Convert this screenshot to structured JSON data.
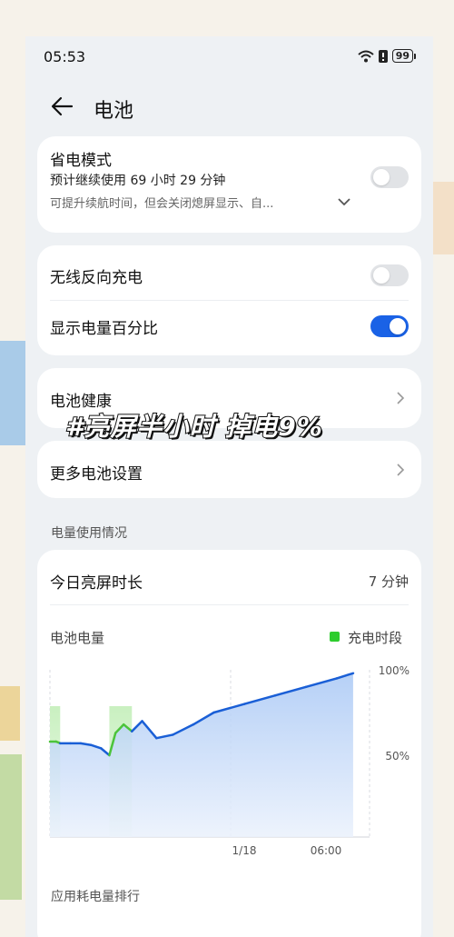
{
  "status_bar": {
    "time": "05:53",
    "battery_level": "99",
    "icons": [
      "wifi-icon",
      "alert-icon",
      "battery-icon"
    ]
  },
  "header": {
    "title": "电池",
    "back_icon": "back-arrow-icon"
  },
  "power_saving": {
    "title": "省电模式",
    "estimate": "预计继续使用 69 小时 29 分钟",
    "description": "可提升续航时间，但会关闭熄屏显示、自...",
    "enabled": false
  },
  "wireless_reverse": {
    "label": "无线反向充电",
    "enabled": false
  },
  "show_percentage": {
    "label": "显示电量百分比",
    "enabled": true
  },
  "battery_health": {
    "label": "电池健康"
  },
  "more_settings": {
    "label": "更多电池设置"
  },
  "overlay_caption": "#亮屏半小时 掉电9%",
  "usage_section": {
    "label": "电量使用情况"
  },
  "screen_time": {
    "label": "今日亮屏时长",
    "value": "7 分钟"
  },
  "chart_header": {
    "title": "电池电量",
    "legend": "充电时段"
  },
  "chart_data": {
    "type": "area",
    "title": "电池电量",
    "legend": [
      "充电时段"
    ],
    "x_tick_labels": [
      "1/18",
      "06:00"
    ],
    "y_tick_labels": [
      "100%",
      "50%"
    ],
    "ylim": [
      0,
      100
    ],
    "x": [
      0,
      3,
      5,
      10,
      15,
      20,
      25,
      29,
      32,
      36,
      40,
      45,
      52,
      60,
      70,
      80,
      95,
      110,
      125,
      140,
      148
    ],
    "values": [
      58,
      58,
      57,
      57,
      57,
      56,
      54,
      50,
      63,
      68,
      64,
      70,
      60,
      62,
      68,
      75,
      80,
      85,
      90,
      95,
      98
    ],
    "charging_segments": [
      [
        0,
        5
      ],
      [
        29,
        40
      ]
    ],
    "colors": {
      "line": "#1a5fd6",
      "charging": "#4cc43a",
      "fill_top": "#a9c8f5",
      "fill_bottom": "#eaf1fc"
    }
  },
  "ranking_section": {
    "label": "应用耗电量排行"
  },
  "colors": {
    "accent": "#1a62e6",
    "legend_green": "#2ecc2e",
    "background": "#eef1f4"
  }
}
